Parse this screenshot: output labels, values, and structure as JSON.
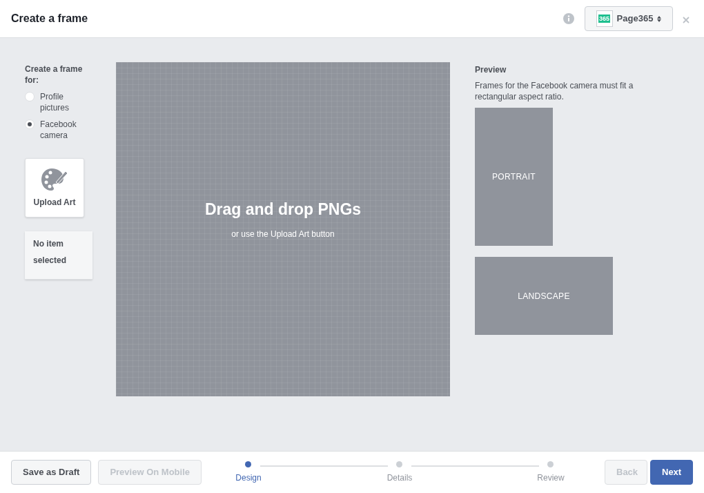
{
  "header": {
    "title": "Create a frame",
    "page_selector": {
      "logo_text": "365",
      "label": "Page365"
    }
  },
  "frame_for": {
    "label": "Create a frame for:",
    "options": [
      {
        "label": "Profile pictures",
        "selected": false
      },
      {
        "label": "Facebook camera",
        "selected": true
      }
    ]
  },
  "upload_button": {
    "label": "Upload Art"
  },
  "item_panel": {
    "text": "No item selected"
  },
  "canvas": {
    "title": "Drag and drop PNGs",
    "subtitle": "or use the Upload Art button"
  },
  "preview": {
    "title": "Preview",
    "description": "Frames for the Facebook camera must fit a rectangular aspect ratio.",
    "frames": [
      {
        "kind": "portrait",
        "label": "PORTRAIT"
      },
      {
        "kind": "landscape",
        "label": "LANDSCAPE"
      }
    ]
  },
  "footer": {
    "buttons_left": [
      {
        "label": "Save as Draft",
        "disabled": false
      },
      {
        "label": "Preview On Mobile",
        "disabled": true
      }
    ],
    "steps": [
      {
        "label": "Design",
        "selected": true
      },
      {
        "label": "Details",
        "selected": false
      },
      {
        "label": "Review",
        "selected": false
      }
    ],
    "buttons_right": [
      {
        "label": "Back",
        "disabled": true
      },
      {
        "label": "Next",
        "disabled": false,
        "kind": "primary"
      }
    ]
  }
}
